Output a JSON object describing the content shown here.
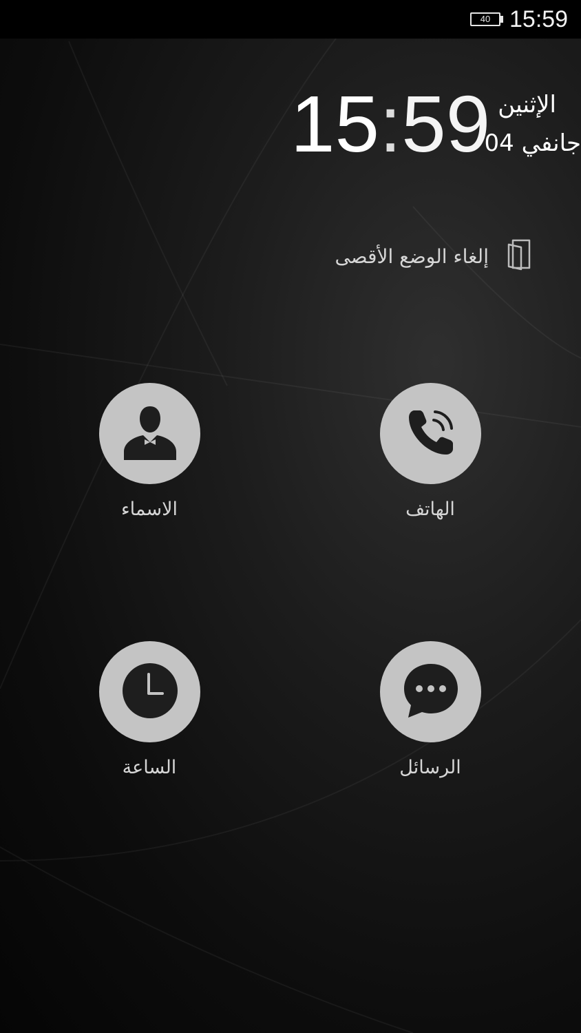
{
  "status_bar": {
    "battery_level": "40",
    "time": "15:59"
  },
  "lockscreen": {
    "clock_hours": "15",
    "clock_separator": ":",
    "clock_minutes": "59",
    "day_name": "الإثنين",
    "date_day": "04",
    "date_month": "جانفي"
  },
  "exit_mode": {
    "label": "إلغاء الوضع الأقصى",
    "icon": "door-exit-icon"
  },
  "apps": [
    {
      "label": "الهاتف",
      "icon": "phone-icon"
    },
    {
      "label": "الاسماء",
      "icon": "contact-person-icon"
    },
    {
      "label": "الرسائل",
      "icon": "message-bubble-icon"
    },
    {
      "label": "الساعة",
      "icon": "clock-icon"
    }
  ],
  "colors": {
    "icon_circle": "#c4c4c4",
    "icon_glyph": "#1e1e1e",
    "text": "#d6d6d6"
  }
}
